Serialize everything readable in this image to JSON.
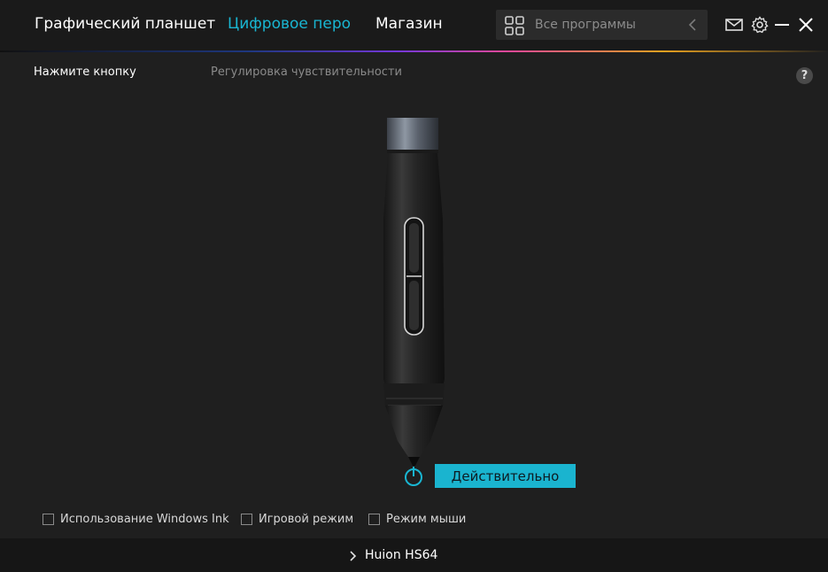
{
  "nav": {
    "tabs": [
      {
        "label": "Графический планшет",
        "active": false
      },
      {
        "label": "Цифровое перо",
        "active": true
      },
      {
        "label": "Магазин",
        "active": false
      }
    ]
  },
  "search": {
    "placeholder": "Все программы",
    "icon": "grid-icon"
  },
  "window_controls": [
    "mail-icon",
    "gear-icon",
    "minimize-icon",
    "close-icon"
  ],
  "subtabs": [
    {
      "label": "Нажмите кнопку",
      "active": true
    },
    {
      "label": "Регулировка чувствительности",
      "active": false
    }
  ],
  "help": {
    "label": "?"
  },
  "pen": {
    "action_button": "Действительно",
    "tip_icon": "power-icon"
  },
  "options": [
    {
      "label": "Использование Windows Ink",
      "checked": false
    },
    {
      "label": "Игровой режим",
      "checked": false
    },
    {
      "label": "Режим мыши",
      "checked": false
    }
  ],
  "footer": {
    "device": "Huion HS64"
  },
  "colors": {
    "accent": "#19b6d2",
    "background": "#1f1f1f",
    "button": "#1ab4cf"
  }
}
